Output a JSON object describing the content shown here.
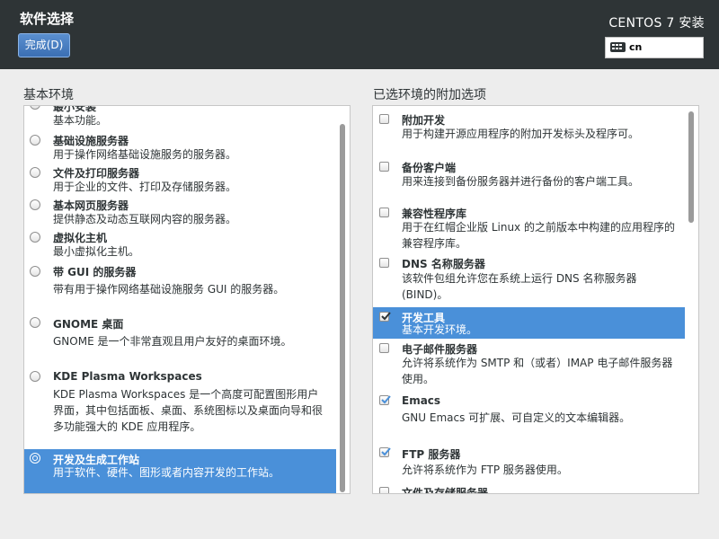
{
  "header": {
    "title": "软件选择",
    "done_label": "完成(D)",
    "product": "CENTOS 7 安装",
    "keyboard_layout": "cn"
  },
  "base_env": {
    "label": "基本环境",
    "items": [
      {
        "title": "最小安装",
        "desc": "基本功能。",
        "selected": false
      },
      {
        "title": "基础设施服务器",
        "desc": "用于操作网络基础设施服务的服务器。",
        "selected": false
      },
      {
        "title": "文件及打印服务器",
        "desc": "用于企业的文件、打印及存储服务器。",
        "selected": false
      },
      {
        "title": "基本网页服务器",
        "desc": "提供静态及动态互联网内容的服务器。",
        "selected": false
      },
      {
        "title": "虚拟化主机",
        "desc": "最小虚拟化主机。",
        "selected": false
      },
      {
        "title": "带 GUI 的服务器",
        "desc": "带有用于操作网络基础设施服务 GUI 的服务器。",
        "selected": false
      },
      {
        "title": "GNOME 桌面",
        "desc": "GNOME 是一个非常直观且用户友好的桌面环境。",
        "selected": false
      },
      {
        "title": "KDE Plasma Workspaces",
        "desc": "KDE Plasma Workspaces 是一个高度可配置图形用户界面，其中包括面板、桌面、系统图标以及桌面向导和很多功能强大的 KDE 应用程序。",
        "selected": false
      },
      {
        "title": "开发及生成工作站",
        "desc": "用于软件、硬件、图形或者内容开发的工作站。",
        "selected": true
      }
    ]
  },
  "addons": {
    "label": "已选环境的附加选项",
    "items": [
      {
        "title": "附加开发",
        "desc": "用于构建开源应用程序的附加开发标头及程序可。",
        "checked": false,
        "selected": false
      },
      {
        "title": "备份客户端",
        "desc": "用来连接到备份服务器并进行备份的客户端工具。",
        "checked": false,
        "selected": false
      },
      {
        "title": "兼容性程序库",
        "desc": "用于在红帽企业版 Linux 的之前版本中构建的应用程序的兼容程序库。",
        "checked": false,
        "selected": false
      },
      {
        "title": "DNS 名称服务器",
        "desc": "该软件包组允许您在系统上运行 DNS 名称服务器(BIND)。",
        "checked": false,
        "selected": false
      },
      {
        "title": "开发工具",
        "desc": "基本开发环境。",
        "checked": true,
        "selected": true
      },
      {
        "title": "电子邮件服务器",
        "desc": "允许将系统作为 SMTP 和（或者）IMAP 电子邮件服务器使用。",
        "checked": false,
        "selected": false
      },
      {
        "title": "Emacs",
        "desc": "GNU Emacs 可扩展、可自定义的文本编辑器。",
        "checked": true,
        "selected": false
      },
      {
        "title": "FTP 服务器",
        "desc": "允许将系统作为 FTP 服务器使用。",
        "checked": true,
        "selected": false
      },
      {
        "title": "文件及存储服务器",
        "desc": "",
        "checked": false,
        "selected": false
      }
    ]
  },
  "colors": {
    "header_bg": "#2e3436",
    "selection": "#4a90d9",
    "window_bg": "#ededed"
  }
}
